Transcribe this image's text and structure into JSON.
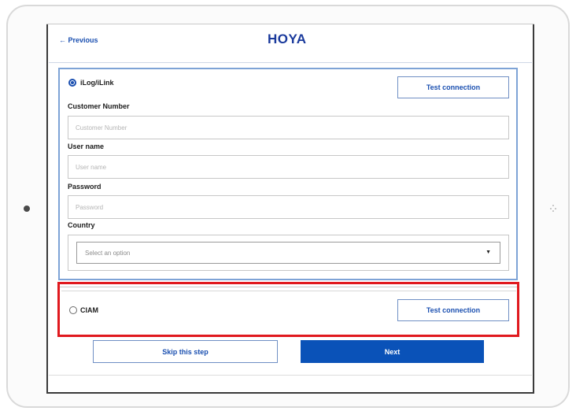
{
  "header": {
    "previous_label": "← Previous",
    "logo_text": "HOYA"
  },
  "ilog": {
    "option_label": "iLog/iLink",
    "selected": true,
    "test_connection_label": "Test connection",
    "customer_number": {
      "label": "Customer Number",
      "placeholder": "Customer Number",
      "value": ""
    },
    "user_name": {
      "label": "User name",
      "placeholder": "User name",
      "value": ""
    },
    "password": {
      "label": "Password",
      "placeholder": "Password",
      "value": ""
    },
    "country": {
      "label": "Country",
      "selected_text": "Select an option"
    }
  },
  "ciam": {
    "option_label": "CIAM",
    "selected": false,
    "test_connection_label": "Test connection"
  },
  "footer": {
    "skip_label": "Skip this step",
    "next_label": "Next"
  },
  "colors": {
    "primary": "#0a52b8",
    "logo": "#1a3a9c",
    "highlight": "#e0191e",
    "panel_border": "#7ea3d6"
  }
}
